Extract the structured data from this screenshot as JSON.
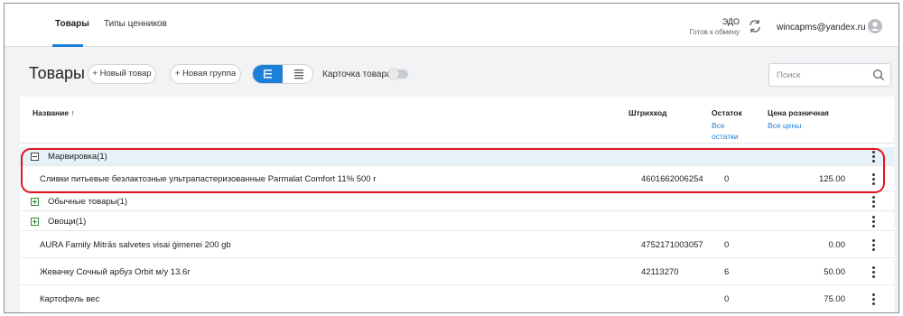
{
  "nav": {
    "tabs": [
      {
        "label": "Товары",
        "active": true
      },
      {
        "label": "Типы ценников",
        "active": false
      }
    ],
    "edo_title": "ЭДО",
    "edo_status": "Готов к обмену",
    "user_email": "wincapms@yandex.ru"
  },
  "toolbar": {
    "title": "Товары",
    "new_product": "+ Новый товар",
    "new_group": "+ Новая группа",
    "card_label": "Карточка товара",
    "card_toggle_on": false,
    "search_placeholder": "Поиск"
  },
  "table": {
    "columns": {
      "name": "Название ↑",
      "barcode": "Штрихкод",
      "stock": "Остаток",
      "stock_link": "Все остатки",
      "price": "Цена розничная",
      "price_link": "Все цены"
    },
    "rows": [
      {
        "kind": "group",
        "label": "Марвировка(1)",
        "expanded": true
      },
      {
        "kind": "item",
        "name": "Сливки питьевые безлактозные ультрапастеризованные Parmalat Comfort 11% 500 г",
        "barcode": "4601662006254",
        "stock": "0",
        "price": "125.00"
      },
      {
        "kind": "group",
        "label": "Обычные товары(1)",
        "expanded": false
      },
      {
        "kind": "group",
        "label": "Овощи(1)",
        "expanded": false
      },
      {
        "kind": "item",
        "name": "AURA Family Mitrās salvetes visai ģimenei 200 gb",
        "barcode": "4752171003057",
        "stock": "0",
        "price": "0.00"
      },
      {
        "kind": "item",
        "name": "Жевачку Сочный арбуз Orbit м/у 13.6г",
        "barcode": "42113270",
        "stock": "6",
        "price": "50.00"
      },
      {
        "kind": "item",
        "name": "Картофель вес",
        "barcode": "",
        "stock": "0",
        "price": "75.00"
      }
    ]
  },
  "colors": {
    "accent": "#1e7fd9",
    "highlight_row": "#e7f1f8",
    "annotation": "#e0141c"
  }
}
